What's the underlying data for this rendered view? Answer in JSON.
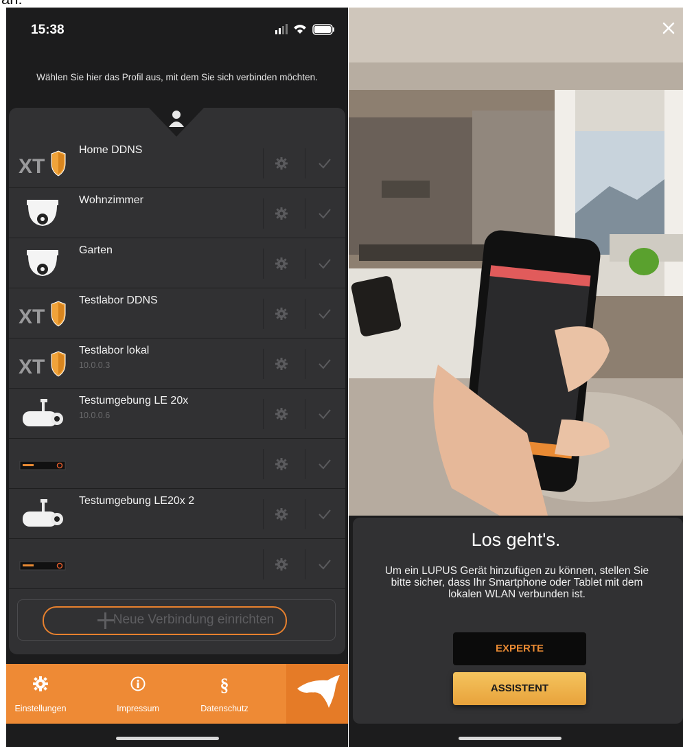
{
  "status_bar": {
    "time": "15:38"
  },
  "intro_text": "Wählen Sie hier das Profil aus, mit dem Sie sich verbinden möchten.",
  "connections": [
    {
      "name": "Home DDNS",
      "sub": "",
      "icon": "xt-shield-icon"
    },
    {
      "name": "Wohnzimmer",
      "sub": "",
      "icon": "dome-camera-icon"
    },
    {
      "name": "Garten",
      "sub": "",
      "icon": "dome-camera-icon"
    },
    {
      "name": "Testlabor DDNS",
      "sub": "",
      "icon": "xt-shield-icon"
    },
    {
      "name": "Testlabor lokal",
      "sub": "10.0.0.3",
      "icon": "xt-shield-icon"
    },
    {
      "name": "Testumgebung LE 20x",
      "sub": "10.0.0.6",
      "icon": "bullet-camera-icon"
    },
    {
      "name": "",
      "sub": "",
      "icon": "recorder-icon"
    },
    {
      "name": "Testumgebung LE20x 2",
      "sub": "",
      "icon": "bullet-camera-icon"
    },
    {
      "name": "",
      "sub": "",
      "icon": "recorder-icon"
    }
  ],
  "new_connection_label": "Neue Verbindung einrichten",
  "bottom_nav": {
    "settings": "Einstellungen",
    "imprint": "Impressum",
    "privacy": "Datenschutz"
  },
  "onboarding": {
    "title": "Los geht's.",
    "description": "Um ein LUPUS Gerät hinzufügen zu können, stellen Sie bitte sicher, dass Ihr Smartphone oder Tablet mit dem lokalen WLAN verbunden ist.",
    "expert_button": "EXPERTE",
    "assistant_button": "ASSISTENT"
  },
  "colors": {
    "accent": "#ee8a35",
    "panel": "#313133",
    "background": "#1c1c1d"
  }
}
